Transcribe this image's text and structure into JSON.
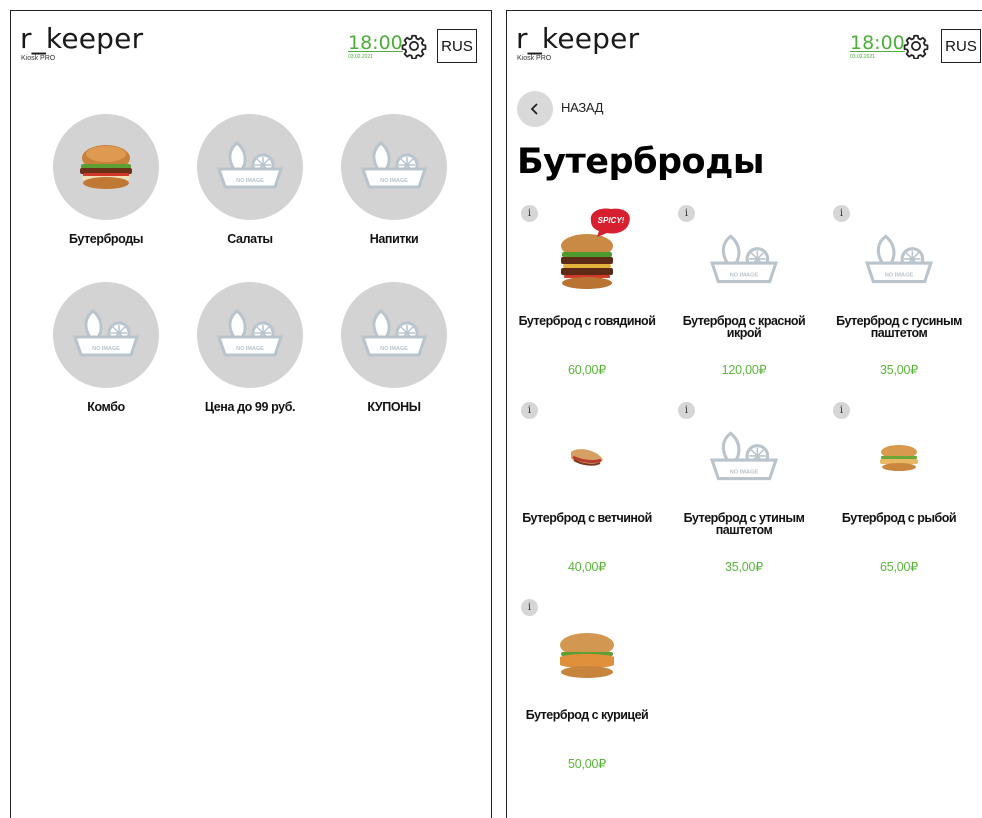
{
  "app": {
    "logo": "r_keeper",
    "logo_sub": "Kiosk PRO",
    "time": "18:00",
    "date": "03.02.2021",
    "language": "RUS"
  },
  "home": {
    "categories": [
      {
        "label": "Бутерброды",
        "image": "burger"
      },
      {
        "label": "Салаты",
        "image": "no-image"
      },
      {
        "label": "Напитки",
        "image": "no-image"
      },
      {
        "label": "Комбо",
        "image": "no-image"
      },
      {
        "label": "Цена до 99 руб.",
        "image": "no-image"
      },
      {
        "label": "КУПОНЫ",
        "image": "no-image"
      }
    ]
  },
  "category_page": {
    "back_label": "НАЗАД",
    "title": "Бутерброды",
    "info_glyph": "i",
    "spicy_badge": "SPICY!",
    "no_image_text": "NO IMAGE",
    "products": [
      {
        "name_line1": "Бутерброд с говядиной",
        "name_line2": "",
        "price": "60,00₽",
        "image": "beef-burger",
        "spicy": true
      },
      {
        "name_line1": "Бутерброд с красной",
        "name_line2": "икрой",
        "price": "120,00₽",
        "image": "no-image",
        "spicy": false
      },
      {
        "name_line1": "Бутерброд с гусиным",
        "name_line2": "паштетом",
        "price": "35,00₽",
        "image": "no-image",
        "spicy": false
      },
      {
        "name_line1": "Бутерброд с ветчиной",
        "name_line2": "",
        "price": "40,00₽",
        "image": "ham-sandwich",
        "spicy": false
      },
      {
        "name_line1": "Бутерброд с утиным",
        "name_line2": "паштетом",
        "price": "35,00₽",
        "image": "no-image",
        "spicy": false
      },
      {
        "name_line1": "Бутерброд с рыбой",
        "name_line2": "",
        "price": "65,00₽",
        "image": "fish-burger",
        "spicy": false
      },
      {
        "name_line1": "Бутерброд с курицей",
        "name_line2": "",
        "price": "50,00₽",
        "image": "chicken-burger",
        "spicy": false
      }
    ]
  },
  "colors": {
    "accent_green": "#4caf3a",
    "placeholder_gray": "#d3d3d3",
    "spicy_red": "#d62030"
  }
}
